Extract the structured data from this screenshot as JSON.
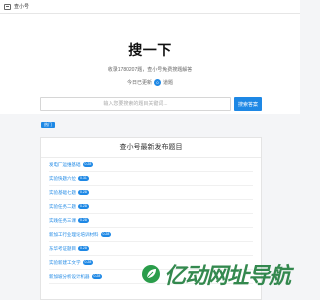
{
  "nav": {
    "brand": "查小号",
    "brand_icon": "window-icon"
  },
  "hero": {
    "title": "搜一下",
    "subtitle": "收录1780207题，查小号免费搜题解答",
    "today_prefix": "今日已更新",
    "today_count": "0",
    "today_suffix": "道题"
  },
  "search": {
    "placeholder": "输入您要搜索的题目关键词...",
    "button_label": "搜索答案"
  },
  "tag": {
    "label": "热门"
  },
  "panel": {
    "title": "查小号最新发布题目",
    "items": [
      {
        "text": "发电厂运维基础",
        "badge": "0.28"
      },
      {
        "text": "实验快题六位",
        "badge": "0.31"
      },
      {
        "text": "实验基础七题",
        "badge": "0.28"
      },
      {
        "text": "实验任务二题",
        "badge": "0.28"
      },
      {
        "text": "实践任务三课",
        "badge": "0.28"
      },
      {
        "text": "新加工行业理论培训材料",
        "badge": "0.28"
      },
      {
        "text": "东华考证题目",
        "badge": "0.28"
      },
      {
        "text": "实验新建工文学",
        "badge": "0.28"
      },
      {
        "text": "新加坡分析设计机器",
        "badge": "0.28"
      }
    ]
  },
  "watermark": {
    "text": "亿动网址导航",
    "logo": "leaf-logo"
  },
  "colors": {
    "accent": "#1e88e5",
    "watermark": "#1f7d3c"
  }
}
